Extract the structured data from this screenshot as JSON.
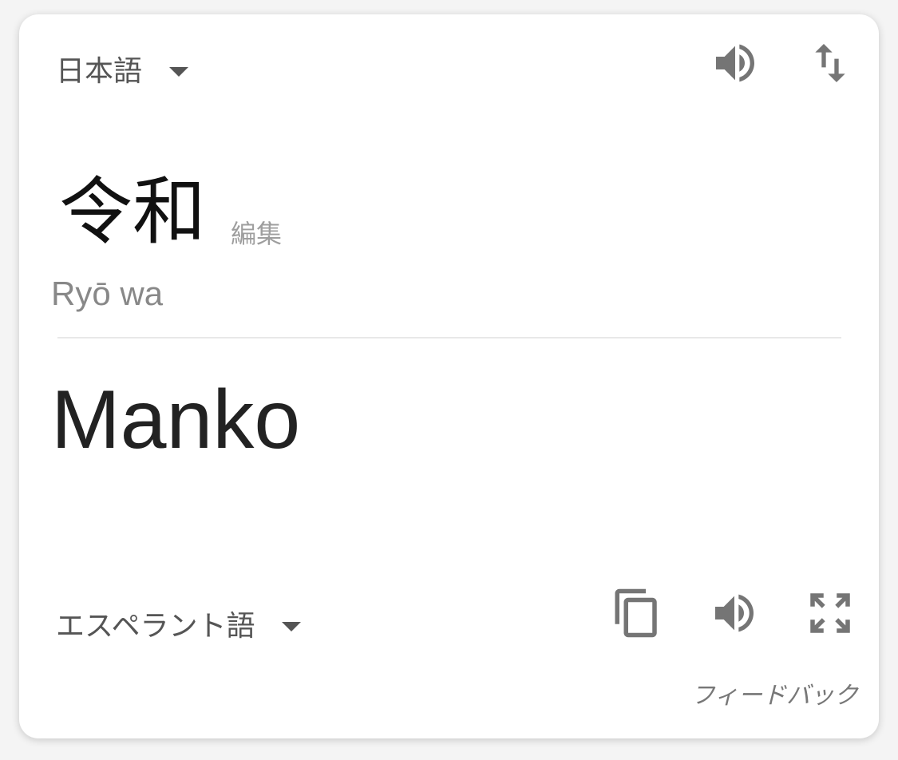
{
  "source": {
    "language": "日本語",
    "text": "令和",
    "edit_label": "編集",
    "romanization": "Ryō wa"
  },
  "target": {
    "language": "エスペラント語",
    "text": "Manko"
  },
  "feedback_label": "フィードバック",
  "icons": {
    "speaker": "speaker-icon",
    "swap": "swap-languages-icon",
    "copy": "copy-icon",
    "fullscreen": "fullscreen-icon",
    "dropdown": "chevron-down-icon"
  },
  "colors": {
    "icon": "#757575",
    "label": "#555555",
    "muted": "#9e9e9e"
  }
}
